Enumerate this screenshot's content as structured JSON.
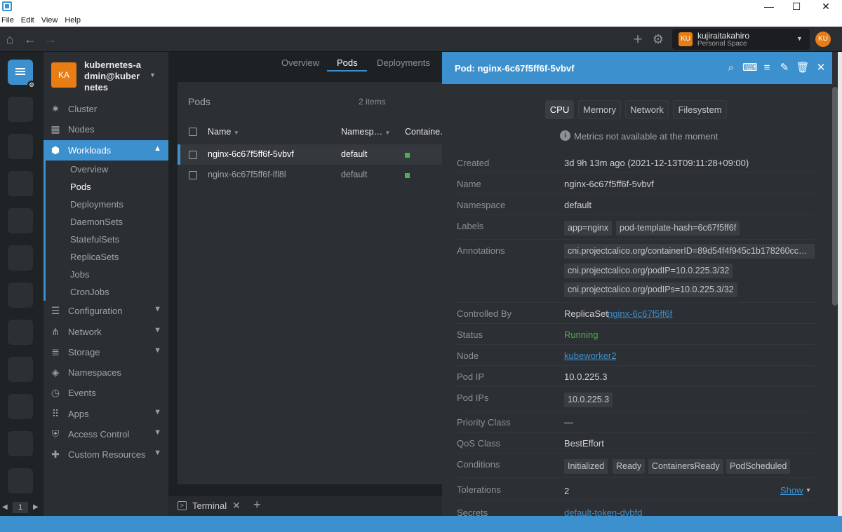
{
  "window": {
    "minimize": "—",
    "maximize": "☐",
    "close": "✕"
  },
  "menu": [
    "File",
    "Edit",
    "View",
    "Help"
  ],
  "space": {
    "avatar": "KU",
    "name": "kujiraitakahiro",
    "subtitle": "Personal Space",
    "user_avatar": "KU"
  },
  "cluster": {
    "avatar": "KA",
    "name": "kubernetes-admin@kubernetes"
  },
  "sidebar": {
    "items": [
      {
        "label": "Cluster"
      },
      {
        "label": "Nodes"
      },
      {
        "label": "Workloads"
      },
      {
        "label": "Configuration"
      },
      {
        "label": "Network"
      },
      {
        "label": "Storage"
      },
      {
        "label": "Namespaces"
      },
      {
        "label": "Events"
      },
      {
        "label": "Apps"
      },
      {
        "label": "Access Control"
      },
      {
        "label": "Custom Resources"
      }
    ],
    "workload_sub": [
      "Overview",
      "Pods",
      "Deployments",
      "DaemonSets",
      "StatefulSets",
      "ReplicaSets",
      "Jobs",
      "CronJobs"
    ]
  },
  "hotbar": {
    "page": "1"
  },
  "tabs": [
    "Overview",
    "Pods",
    "Deployments"
  ],
  "pods": {
    "title": "Pods",
    "count": "2 items",
    "columns": [
      "Name",
      "Namesp…",
      "Containe…"
    ],
    "rows": [
      {
        "name": "nginx-6c67f5ff6f-5vbvf",
        "namespace": "default"
      },
      {
        "name": "nginx-6c67f5ff6f-lfl8l",
        "namespace": "default"
      }
    ]
  },
  "terminal": {
    "label": "Terminal",
    "close": "✕",
    "add": "+"
  },
  "detail": {
    "title": "Pod: nginx-6c67f5ff6f-5vbvf",
    "metric_tabs": [
      "CPU",
      "Memory",
      "Network",
      "Filesystem"
    ],
    "metrics_message": "Metrics not available at the moment",
    "created_label": "Created",
    "created": "3d 9h 13m ago (2021-12-13T09:11:28+09:00)",
    "name_label": "Name",
    "name": "nginx-6c67f5ff6f-5vbvf",
    "namespace_label": "Namespace",
    "namespace": "default",
    "labels_label": "Labels",
    "labels": [
      "app=nginx",
      "pod-template-hash=6c67f5ff6f"
    ],
    "annotations_label": "Annotations",
    "annotations": [
      "cni.projectcalico.org/containerID=89d54f4f945c1b178260cc…",
      "cni.projectcalico.org/podIP=10.0.225.3/32",
      "cni.projectcalico.org/podIPs=10.0.225.3/32"
    ],
    "controlled_by_label": "Controlled By",
    "controlled_by_kind": "ReplicaSet",
    "controlled_by_link": "nginx-6c67f5ff6f",
    "status_label": "Status",
    "status": "Running",
    "node_label": "Node",
    "node": "kubeworker2",
    "pod_ip_label": "Pod IP",
    "pod_ip": "10.0.225.3",
    "pod_ips_label": "Pod IPs",
    "pod_ips": "10.0.225.3",
    "priority_label": "Priority Class",
    "priority": "—",
    "qos_label": "QoS Class",
    "qos": "BestEffort",
    "conditions_label": "Conditions",
    "conditions": [
      "Initialized",
      "Ready",
      "ContainersReady",
      "PodScheduled"
    ],
    "tolerations_label": "Tolerations",
    "tolerations": "2",
    "show": "Show",
    "secrets_label": "Secrets",
    "secret": "default-token-dvbfd"
  },
  "colors": {
    "accent": "#3d90ce",
    "running": "#4caf50",
    "avatar": "#e97d15"
  }
}
